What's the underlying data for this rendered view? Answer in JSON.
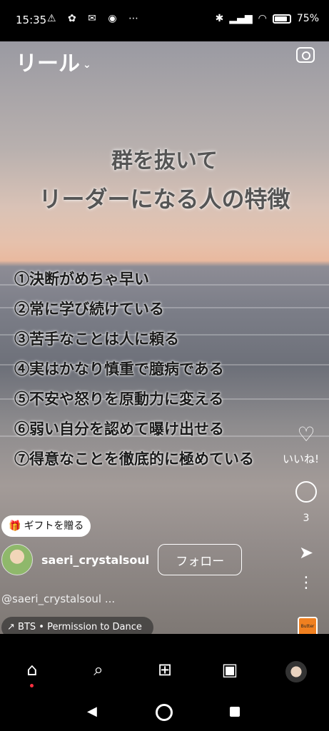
{
  "status": {
    "time": "15:35",
    "left_icons": "⚠ ✿ ✉ ◉ ⋯",
    "battery": "75%"
  },
  "header": {
    "title": "リール",
    "chevron": "⌄"
  },
  "reel": {
    "title_line1": "群を抜いて",
    "title_line2": "リーダーになる人の特徴",
    "items": [
      "①決断がめちゃ早い",
      "②常に学び続けている",
      "③苦手なことは人に頼る",
      "④実はかなり慎重で臆病である",
      "⑤不安や怒りを原動力に変える",
      "⑥弱い自分を認めて曝け出せる",
      "⑦得意なことを徹底的に極めている"
    ]
  },
  "actions": {
    "like_label": "いいね!",
    "comment_count": "3"
  },
  "post": {
    "gift_label": "ギフトを贈る",
    "username": "saeri_crystalsoul",
    "follow_label": "フォロー",
    "caption": "@saeri_crystalsoul ...",
    "audio": "BTS • Permission to Dance"
  },
  "audio_thumb_text": "Butter"
}
